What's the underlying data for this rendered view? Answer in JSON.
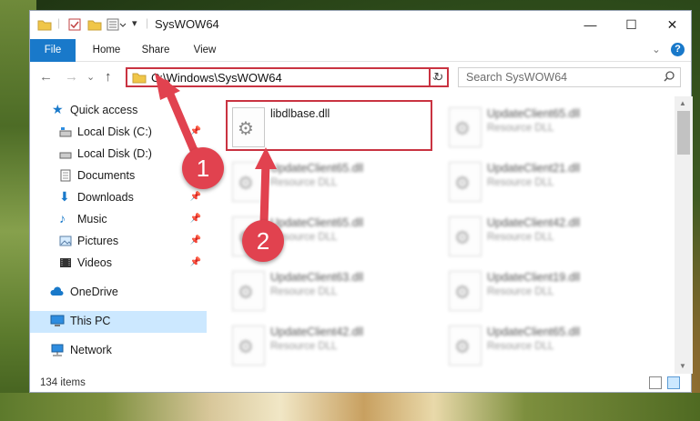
{
  "window": {
    "title": "SysWOW64",
    "minimize": "—",
    "maximize": "☐",
    "close": "✕"
  },
  "ribbon": {
    "tabs": [
      "File",
      "Home",
      "Share",
      "View"
    ],
    "expand": "⌄",
    "help": "?"
  },
  "address": {
    "path": "C:\\Windows\\SysWOW64",
    "dropdown": "⌄",
    "refresh": "↻",
    "search_placeholder": "Search SysWOW64",
    "nav": {
      "back": "←",
      "forward": "→",
      "recent": "⌄",
      "up": "↑"
    }
  },
  "sidebar": {
    "items": [
      {
        "label": "Quick access",
        "icon": "star-icon",
        "pinned": false
      },
      {
        "label": "Local Disk (C:)",
        "icon": "drive-icon",
        "pinned": true
      },
      {
        "label": "Local Disk (D:)",
        "icon": "drive-icon",
        "pinned": true
      },
      {
        "label": "Documents",
        "icon": "document-icon",
        "pinned": true
      },
      {
        "label": "Downloads",
        "icon": "download-icon",
        "pinned": true
      },
      {
        "label": "Music",
        "icon": "music-icon",
        "pinned": true
      },
      {
        "label": "Pictures",
        "icon": "pictures-icon",
        "pinned": true
      },
      {
        "label": "Videos",
        "icon": "video-icon",
        "pinned": true
      },
      {
        "label": "OneDrive",
        "icon": "cloud-icon",
        "pinned": false
      },
      {
        "label": "This PC",
        "icon": "computer-icon",
        "pinned": false,
        "selected": true
      },
      {
        "label": "Network",
        "icon": "network-icon",
        "pinned": false
      }
    ]
  },
  "files": [
    {
      "name": "libdlbase.dll",
      "desc": ""
    },
    {
      "name": "UpdateClient65.dll",
      "desc": "Resource DLL"
    },
    {
      "name": "UpdateClient65.dll",
      "desc": "Resource DLL"
    },
    {
      "name": "UpdateClient21.dll",
      "desc": "Resource DLL"
    },
    {
      "name": "UpdateClient65.dll",
      "desc": "Resource DLL"
    },
    {
      "name": "UpdateClient42.dll",
      "desc": "Resource DLL"
    },
    {
      "name": "UpdateClient63.dll",
      "desc": "Resource DLL"
    },
    {
      "name": "UpdateClient19.dll",
      "desc": "Resource DLL"
    },
    {
      "name": "UpdateClient42.dll",
      "desc": "Resource DLL"
    },
    {
      "name": "UpdateClient65.dll",
      "desc": "Resource DLL"
    }
  ],
  "status": {
    "count": "134 items"
  },
  "annotations": {
    "step1": "1",
    "step2": "2"
  },
  "colors": {
    "accent": "#1979ca",
    "highlight": "#c93341",
    "badge": "#e1424f",
    "selection": "#cce8ff"
  }
}
